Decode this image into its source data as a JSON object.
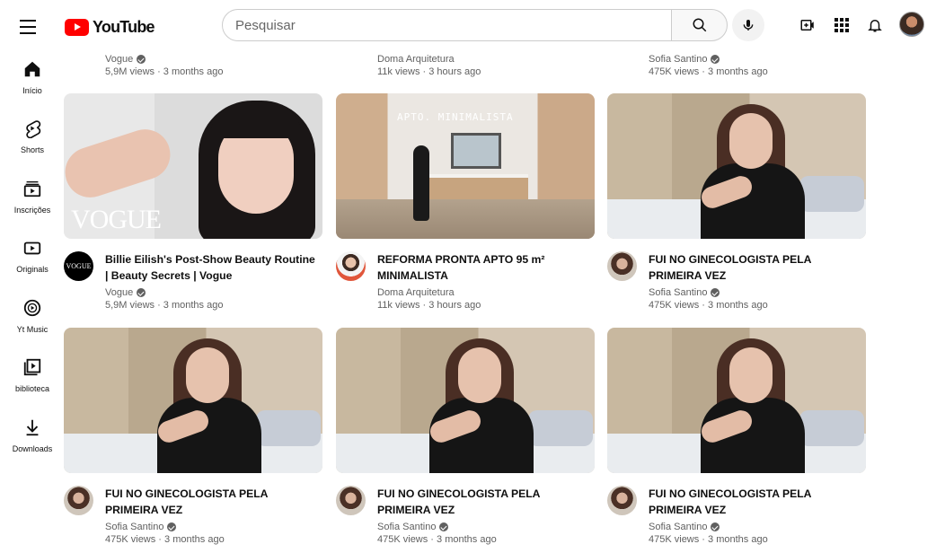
{
  "header": {
    "logo_text": "YouTube",
    "search_placeholder": "Pesquisar"
  },
  "sidebar": {
    "items": [
      {
        "label": "Início",
        "icon": "home-icon"
      },
      {
        "label": "Shorts",
        "icon": "shorts-icon"
      },
      {
        "label": "Inscrições",
        "icon": "subscriptions-icon"
      },
      {
        "label": "Originals",
        "icon": "originals-icon"
      },
      {
        "label": "Yt Music",
        "icon": "music-icon"
      },
      {
        "label": "biblioteca",
        "icon": "library-icon"
      },
      {
        "label": "Downloads",
        "icon": "download-icon"
      }
    ]
  },
  "top_row": [
    {
      "channel": "Vogue",
      "stats": "5,9M views · 3 months ago",
      "verified": true
    },
    {
      "channel": "Doma Arquitetura",
      "stats": "11k views · 3 hours ago",
      "verified": false
    },
    {
      "channel": "Sofia Santino",
      "stats": "475K views · 3 months ago",
      "verified": true
    }
  ],
  "videos": [
    {
      "title": "Billie Eilish's Post-Show Beauty Routine | Beauty Secrets | Vogue",
      "channel": "Vogue",
      "stats": "5,9M views · 3 months ago",
      "verified": true,
      "thumb_text": "VOGUE",
      "avatar_text": "VOGUE"
    },
    {
      "title": "REFORMA PRONTA APTO 95 m² MINIMALISTA",
      "channel": "Doma Arquitetura",
      "stats": "11k views · 3 hours ago",
      "verified": false,
      "thumb_text": "APTO. MINIMALISTA"
    },
    {
      "title": "FUI NO GINECOLOGISTA PELA PRIMEIRA VEZ",
      "channel": "Sofia Santino",
      "stats": "475K views · 3 months ago",
      "verified": true
    },
    {
      "title": "FUI NO GINECOLOGISTA PELA PRIMEIRA VEZ",
      "channel": "Sofia Santino",
      "stats": "475K views · 3 months ago",
      "verified": true
    },
    {
      "title": "FUI NO GINECOLOGISTA PELA PRIMEIRA VEZ",
      "channel": "Sofia Santino",
      "stats": "475K views · 3 months ago",
      "verified": true
    },
    {
      "title": "FUI NO GINECOLOGISTA PELA PRIMEIRA VEZ",
      "channel": "Sofia Santino",
      "stats": "475K views · 3 months ago",
      "verified": true
    }
  ],
  "colors": {
    "brand_red": "#ff0000",
    "meta_gray": "#606060"
  }
}
